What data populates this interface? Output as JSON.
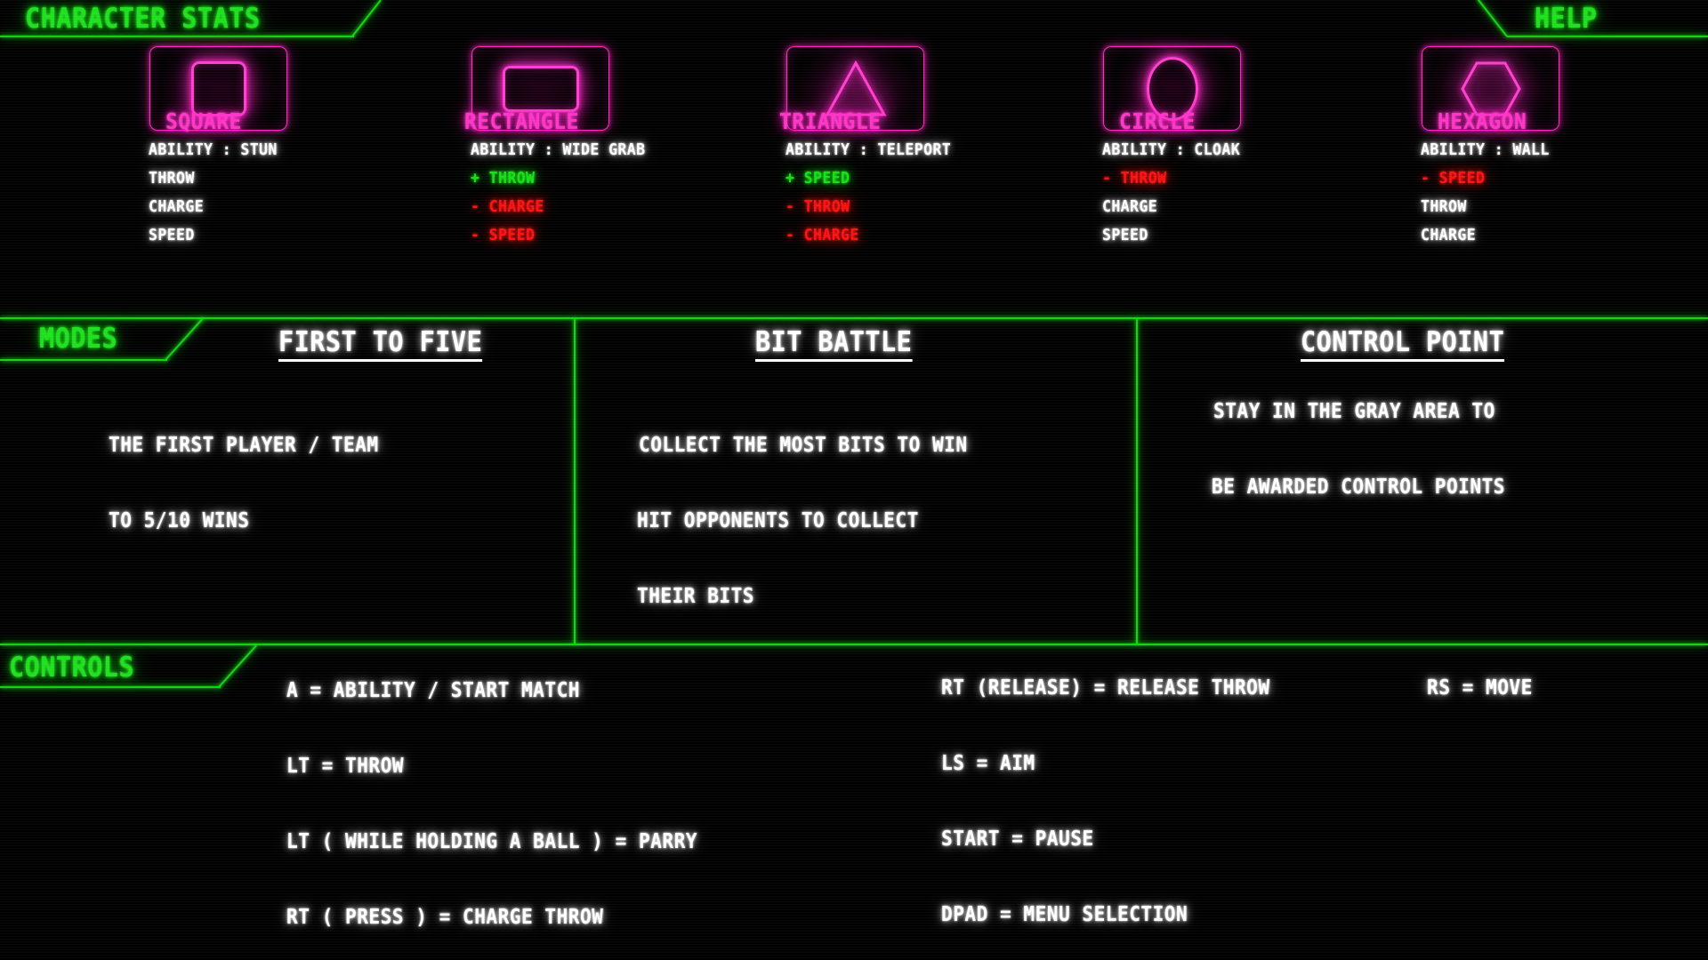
{
  "colors": {
    "green": "#1fe01f",
    "pink": "#ff35c8",
    "red": "#ff1212",
    "white": "#ffffff",
    "background": "#000000"
  },
  "header": {
    "stats_tab": "CHARACTER STATS",
    "help_tab": "HELP"
  },
  "characters": [
    {
      "name": "SQUARE",
      "shape_icon": "square-shape-icon",
      "stats": [
        {
          "text": "ABILITY : STUN",
          "tone": "white"
        },
        {
          "text": "THROW",
          "tone": "white"
        },
        {
          "text": "CHARGE",
          "tone": "white"
        },
        {
          "text": "SPEED",
          "tone": "white"
        }
      ]
    },
    {
      "name": "RECTANGLE",
      "shape_icon": "rectangle-shape-icon",
      "stats": [
        {
          "text": "ABILITY : WIDE GRAB",
          "tone": "white"
        },
        {
          "text": "+ THROW",
          "tone": "green"
        },
        {
          "text": "- CHARGE",
          "tone": "red"
        },
        {
          "text": "- SPEED",
          "tone": "red"
        }
      ]
    },
    {
      "name": "TRIANGLE",
      "shape_icon": "triangle-shape-icon",
      "stats": [
        {
          "text": "ABILITY : TELEPORT",
          "tone": "white"
        },
        {
          "text": "+ SPEED",
          "tone": "green"
        },
        {
          "text": "- THROW",
          "tone": "red"
        },
        {
          "text": "- CHARGE",
          "tone": "red"
        }
      ]
    },
    {
      "name": "CIRCLE",
      "shape_icon": "circle-shape-icon",
      "stats": [
        {
          "text": "ABILITY : CLOAK",
          "tone": "white"
        },
        {
          "text": "- THROW",
          "tone": "red"
        },
        {
          "text": "CHARGE",
          "tone": "white"
        },
        {
          "text": "SPEED",
          "tone": "white"
        }
      ]
    },
    {
      "name": "HEXAGON",
      "shape_icon": "hexagon-shape-icon",
      "stats": [
        {
          "text": "ABILITY : WALL",
          "tone": "white"
        },
        {
          "text": "- SPEED",
          "tone": "red"
        },
        {
          "text": "THROW",
          "tone": "white"
        },
        {
          "text": "CHARGE",
          "tone": "white"
        }
      ]
    }
  ],
  "modes": {
    "tab_label": "MODES",
    "panels": [
      {
        "title": "FIRST TO FIVE",
        "lines": [
          "THE FIRST PLAYER / TEAM",
          "TO 5/10 WINS"
        ]
      },
      {
        "title": "BIT BATTLE",
        "lines": [
          "COLLECT THE MOST BITS TO WIN",
          "HIT OPPONENTS TO COLLECT",
          "THEIR BITS"
        ]
      },
      {
        "title": "CONTROL POINT",
        "lines": [
          "STAY IN THE GRAY AREA TO",
          "BE AWARDED CONTROL POINTS"
        ]
      }
    ]
  },
  "controls": {
    "tab_label": "CONTROLS",
    "left_column": [
      "A = ABILITY / START MATCH",
      "LT = THROW",
      "LT ( WHILE HOLDING A BALL ) = PARRY",
      "RT ( PRESS ) = CHARGE THROW"
    ],
    "right_column": [
      "RT (RELEASE)  =  RELEASE THROW",
      "LS =  AIM",
      "START =  PAUSE",
      "DPAD  =  MENU SELECTION"
    ],
    "right_overlay": "RS = MOVE"
  }
}
